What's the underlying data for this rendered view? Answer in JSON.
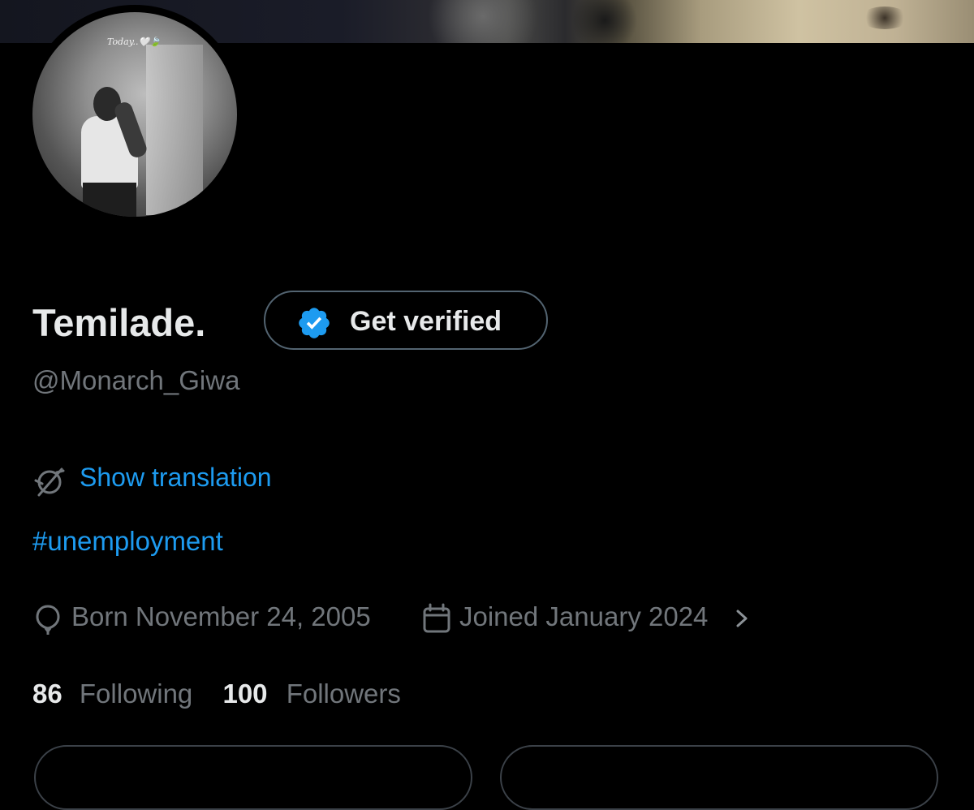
{
  "profile": {
    "avatar_caption": "Today..🤍🍃",
    "display_name": "Temilade.",
    "verify_button_label": "Get verified",
    "handle": "@Monarch_Giwa",
    "translation_link": "Show translation",
    "bio_hashtag": "#unemployment",
    "born": "Born November 24, 2005",
    "joined": "Joined January 2024",
    "following_count": "86",
    "following_label": "Following",
    "followers_count": "100",
    "followers_label": "Followers"
  },
  "icons": {
    "verified": "verified-badge-icon",
    "translate": "translate-globe-icon",
    "born": "balloon-icon",
    "joined": "calendar-icon",
    "more": "chevron-right-icon"
  },
  "colors": {
    "background": "#000000",
    "link": "#1d9bf0",
    "primary_text": "#e7e9ea",
    "secondary_text": "#71767b",
    "border": "#536471"
  }
}
